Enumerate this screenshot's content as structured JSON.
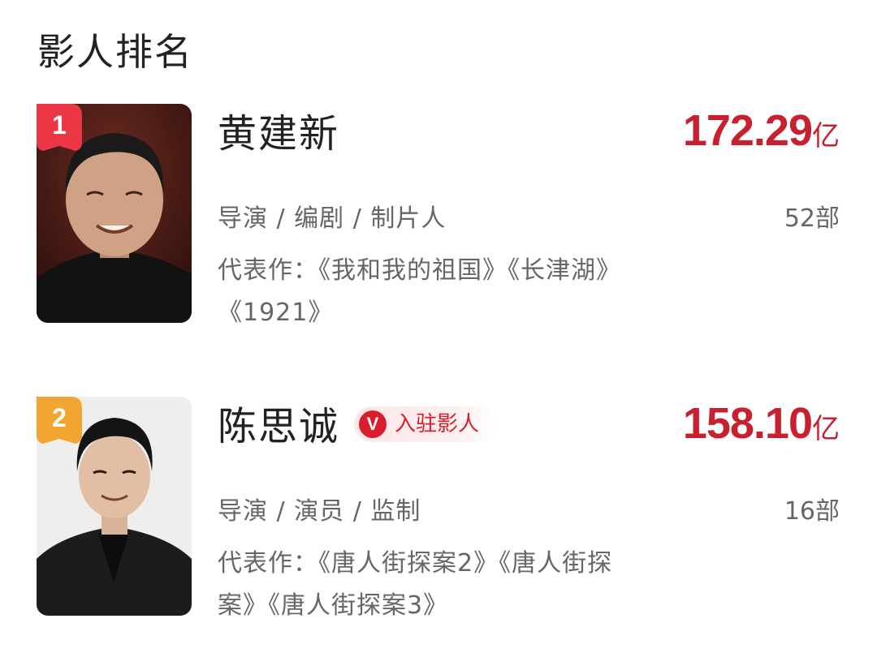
{
  "section": {
    "title": "影人排名"
  },
  "colors": {
    "accent": "#c8202e",
    "rank1": "#ea3645",
    "rank2": "#f2a530",
    "text_secondary": "#666666"
  },
  "people": [
    {
      "rank": "1",
      "name": "黄建新",
      "box_office_value": "172.29",
      "box_office_unit": "亿",
      "roles": "导演 / 编剧 / 制片人",
      "film_count": "52部",
      "works_line1": "代表作：《我和我的祖国》《长津湖》",
      "works_line2": "《1921》",
      "photo_icon": "portrait-photo"
    },
    {
      "rank": "2",
      "name": "陈思诚",
      "verified_badge": {
        "icon": "V",
        "label": "入驻影人"
      },
      "box_office_value": "158.10",
      "box_office_unit": "亿",
      "roles": "导演 / 演员 / 监制",
      "film_count": "16部",
      "works_line1": "代表作：《唐人街探案2》《唐人街探",
      "works_line2": "案》《唐人街探案3》",
      "photo_icon": "portrait-photo"
    }
  ]
}
